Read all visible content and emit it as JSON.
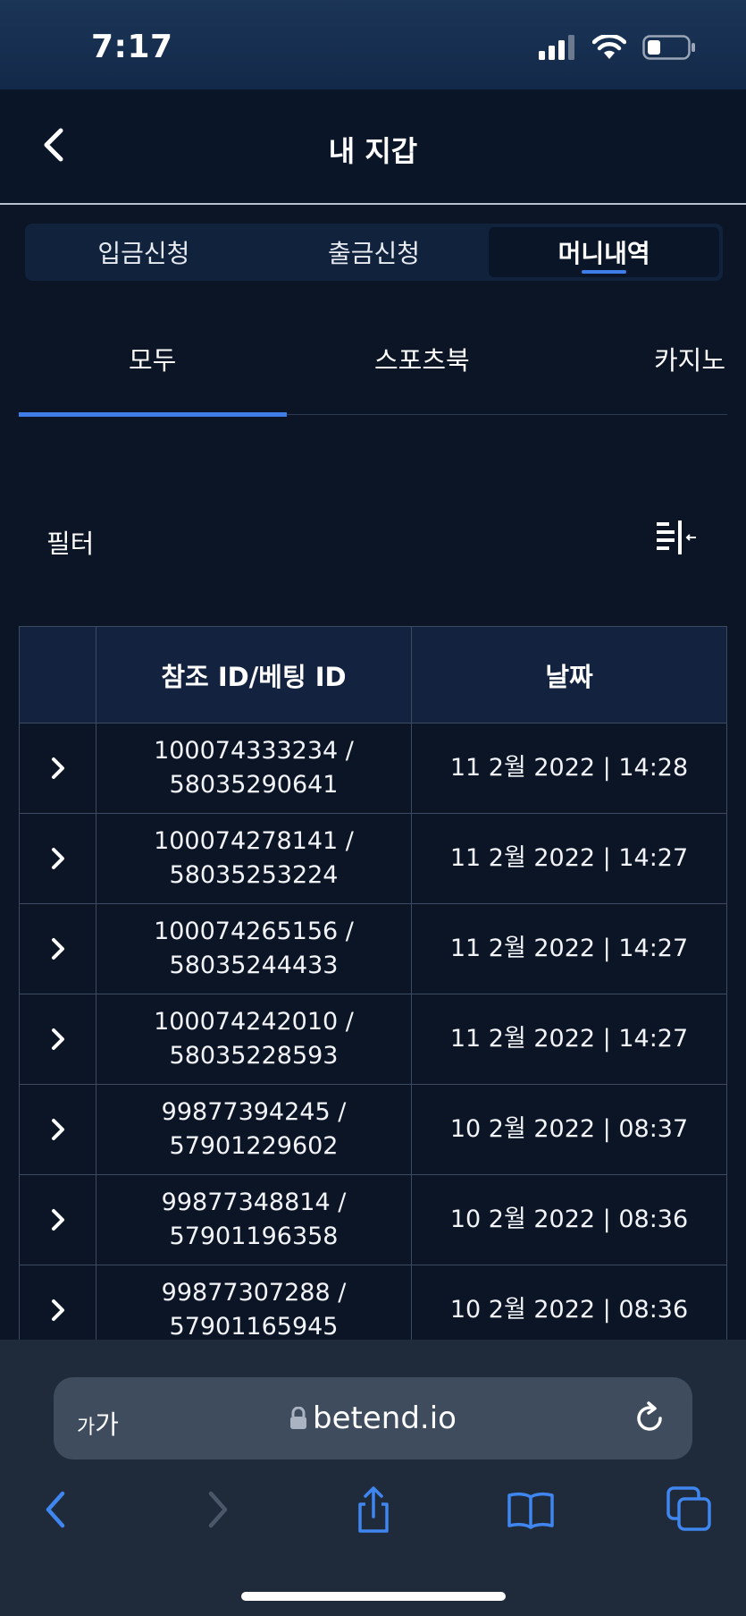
{
  "status_bar": {
    "time": "7:17",
    "icons": [
      "cellular-signal-icon",
      "wifi-icon",
      "battery-icon"
    ]
  },
  "header": {
    "title": "내 지갑",
    "back_icon": "chevron-left-icon"
  },
  "segment_tabs": [
    {
      "label": "입금신청",
      "active": false
    },
    {
      "label": "출금신청",
      "active": false
    },
    {
      "label": "머니내역",
      "active": true
    }
  ],
  "category_tabs": [
    {
      "label": "모두",
      "active": true
    },
    {
      "label": "스포츠북",
      "active": false
    },
    {
      "label": "카지노",
      "active": false
    }
  ],
  "filter": {
    "label": "필터",
    "icon": "filter-toggle-icon"
  },
  "table": {
    "headers": [
      "",
      "참조 ID/베팅 ID",
      "날짜"
    ],
    "rows": [
      {
        "ref_id": "100074333234 /",
        "bet_id": "58035290641",
        "date": "11 2월 2022 | 14:28"
      },
      {
        "ref_id": "100074278141 /",
        "bet_id": "58035253224",
        "date": "11 2월 2022 | 14:27"
      },
      {
        "ref_id": "100074265156 /",
        "bet_id": "58035244433",
        "date": "11 2월 2022 | 14:27"
      },
      {
        "ref_id": "100074242010 /",
        "bet_id": "58035228593",
        "date": "11 2월 2022 | 14:27"
      },
      {
        "ref_id": "99877394245 /",
        "bet_id": "57901229602",
        "date": "10 2월 2022 | 08:37"
      },
      {
        "ref_id": "99877348814 /",
        "bet_id": "57901196358",
        "date": "10 2월 2022 | 08:36"
      },
      {
        "ref_id": "99877307288 /",
        "bet_id": "57901165945",
        "date": "10 2월 2022 | 08:36"
      }
    ]
  },
  "browser": {
    "aa_small": "가",
    "aa_large": "가",
    "url": "betend.io",
    "toolbar_icons": [
      "back-icon",
      "forward-icon",
      "share-icon",
      "bookmarks-icon",
      "tabs-icon"
    ]
  },
  "colors": {
    "background": "#0b1526",
    "accent": "#3f7ee8",
    "table_header": "#13223e",
    "safari_bar": "#1f2b3a"
  }
}
